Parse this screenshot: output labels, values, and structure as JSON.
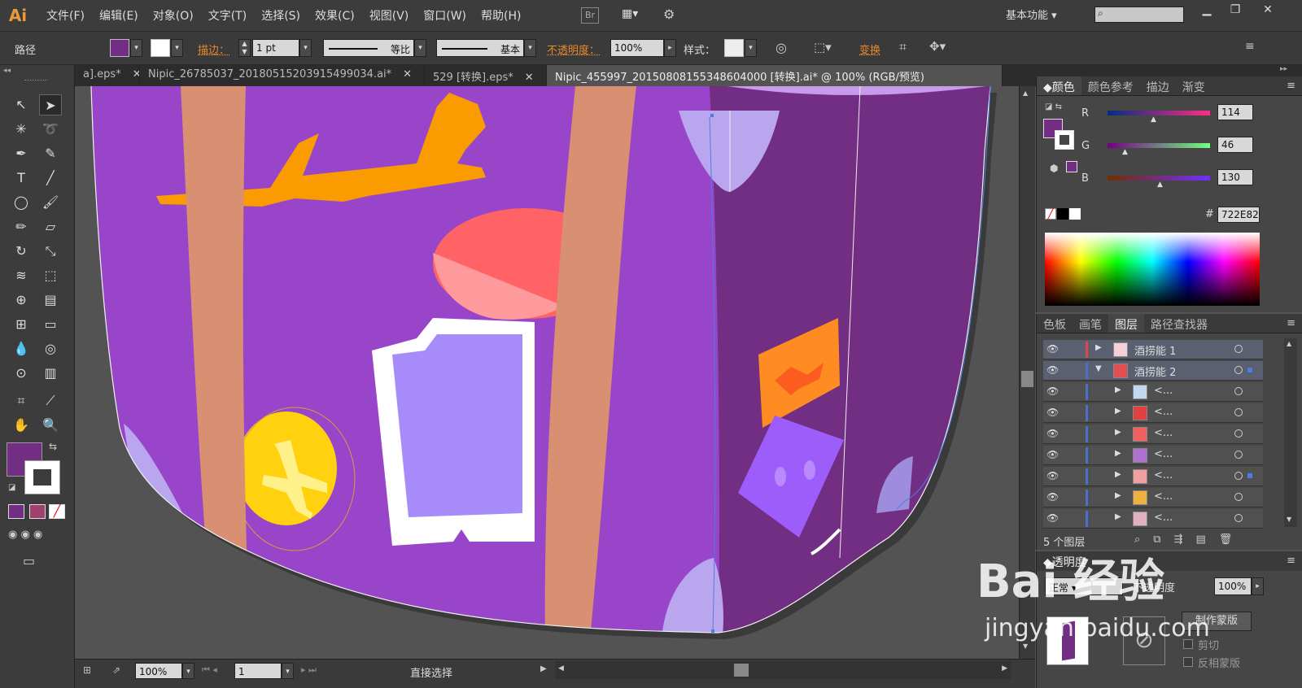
{
  "app": {
    "logo": "Ai"
  },
  "menu": [
    "文件(F)",
    "编辑(E)",
    "对象(O)",
    "文字(T)",
    "选择(S)",
    "效果(C)",
    "视图(V)",
    "窗口(W)",
    "帮助(H)"
  ],
  "br_badge": "Br",
  "workspace": "基本功能",
  "control": {
    "selection_type": "路径",
    "stroke_label": "描边：",
    "stroke_weight": "1 pt",
    "profile": "等比",
    "brush": "基本",
    "opacity_label": "不透明度：",
    "opacity_value": "100%",
    "style_label": "样式：",
    "transform_label": "变换",
    "fill_color": "#722E82"
  },
  "tabs": [
    {
      "label": "a].eps*"
    },
    {
      "label": "Nipic_26785037_20180515203915499034.ai*"
    },
    {
      "label": "529 [转换].eps*"
    },
    {
      "label": "Nipic_455997_20150808155348604000 [转换].ai* @ 100% (RGB/预览)"
    }
  ],
  "color_panel": {
    "tabs": [
      "颜色",
      "颜色参考",
      "描边",
      "渐变"
    ],
    "r": "114",
    "g": "46",
    "b": "130",
    "r_label": "R",
    "g_label": "G",
    "b_label": "B",
    "hex_label": "#",
    "hex": "722E82"
  },
  "layers_panel": {
    "tabs": [
      "色板",
      "画笔",
      "图层",
      "路径查找器"
    ],
    "layers": [
      {
        "name": "酒捞能 1",
        "expanded": false,
        "indent": 0
      },
      {
        "name": "酒捞能 2",
        "expanded": true,
        "indent": 0
      },
      {
        "name": "<...",
        "indent": 1
      },
      {
        "name": "<...",
        "indent": 1
      },
      {
        "name": "<...",
        "indent": 1
      },
      {
        "name": "<...",
        "indent": 1
      },
      {
        "name": "<...",
        "indent": 1
      },
      {
        "name": "<...",
        "indent": 1
      },
      {
        "name": "<...",
        "indent": 1
      }
    ],
    "count": "5 个图层"
  },
  "transparency_panel": {
    "title": "透明度",
    "mode": "正常",
    "opacity_label": "不透明度",
    "opacity": "100%",
    "make_mask": "制作蒙版",
    "clip": "剪切",
    "invert": "反相蒙版"
  },
  "status": {
    "zoom": "100%",
    "page": "1",
    "tool": "直接选择"
  },
  "watermark": {
    "brand": "Bai  经验",
    "url": "jingyan.baidu.com"
  }
}
